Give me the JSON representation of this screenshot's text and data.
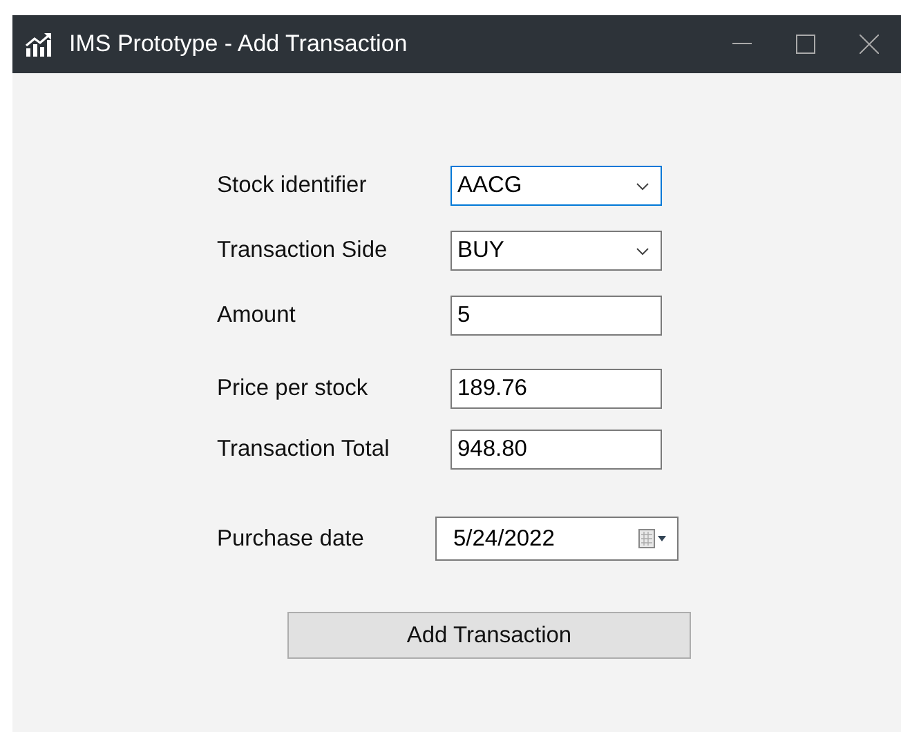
{
  "window": {
    "title": "IMS Prototype - Add Transaction"
  },
  "fields": [
    {
      "label": "Stock identifier",
      "kind": "combo",
      "value": "AACG",
      "focused": true
    },
    {
      "label": "Transaction Side",
      "kind": "combo",
      "value": "BUY",
      "focused": false
    },
    {
      "label": "Amount",
      "kind": "text",
      "value": "5",
      "focused": false
    },
    {
      "label": "Price per stock",
      "kind": "text",
      "value": "189.76",
      "focused": false
    },
    {
      "label": "Transaction Total",
      "kind": "text",
      "value": "948.80",
      "focused": false
    },
    {
      "label": "Purchase date",
      "kind": "date",
      "value": "5/24/2022",
      "focused": false
    }
  ],
  "button": {
    "label": "Add Transaction"
  }
}
